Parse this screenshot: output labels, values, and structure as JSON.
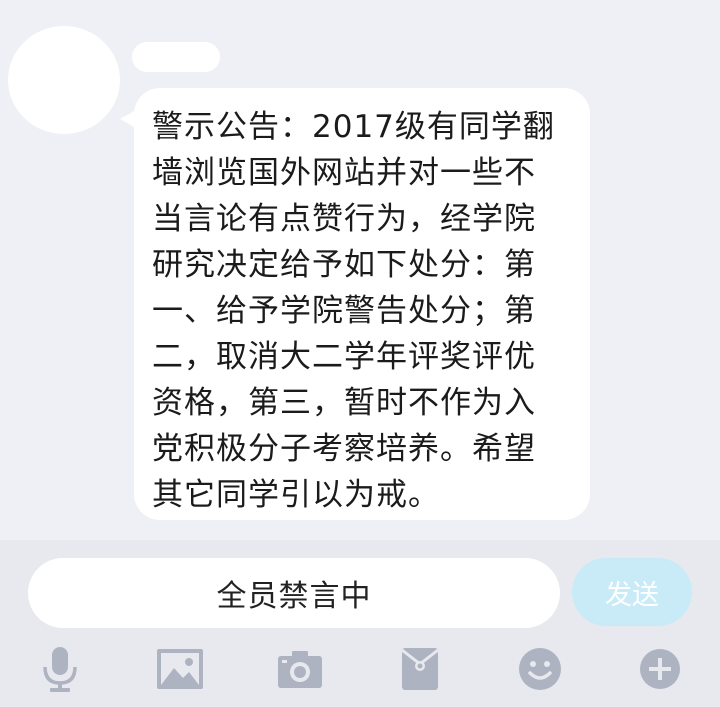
{
  "chat": {
    "sender_name": "",
    "message_lines": [
      "警示公告：2017级有同学翻",
      "墙浏览国外网站并对一些不",
      "当言论有点赞行为，经学院",
      "研究决定给予如下处分：第",
      "一、给予学院警告处分；第",
      "二，取消大二学年评奖评优",
      "资格，第三，暂时不作为入",
      "党积极分子考察培养。希望",
      "其它同学引以为戒。"
    ]
  },
  "input": {
    "status_text": "全员禁言中",
    "send_label": "发送"
  },
  "toolbar": {
    "icons": [
      "microphone-icon",
      "image-icon",
      "camera-icon",
      "red-packet-icon",
      "emoji-icon",
      "plus-icon"
    ],
    "icon_color": "#aeb3c1"
  }
}
